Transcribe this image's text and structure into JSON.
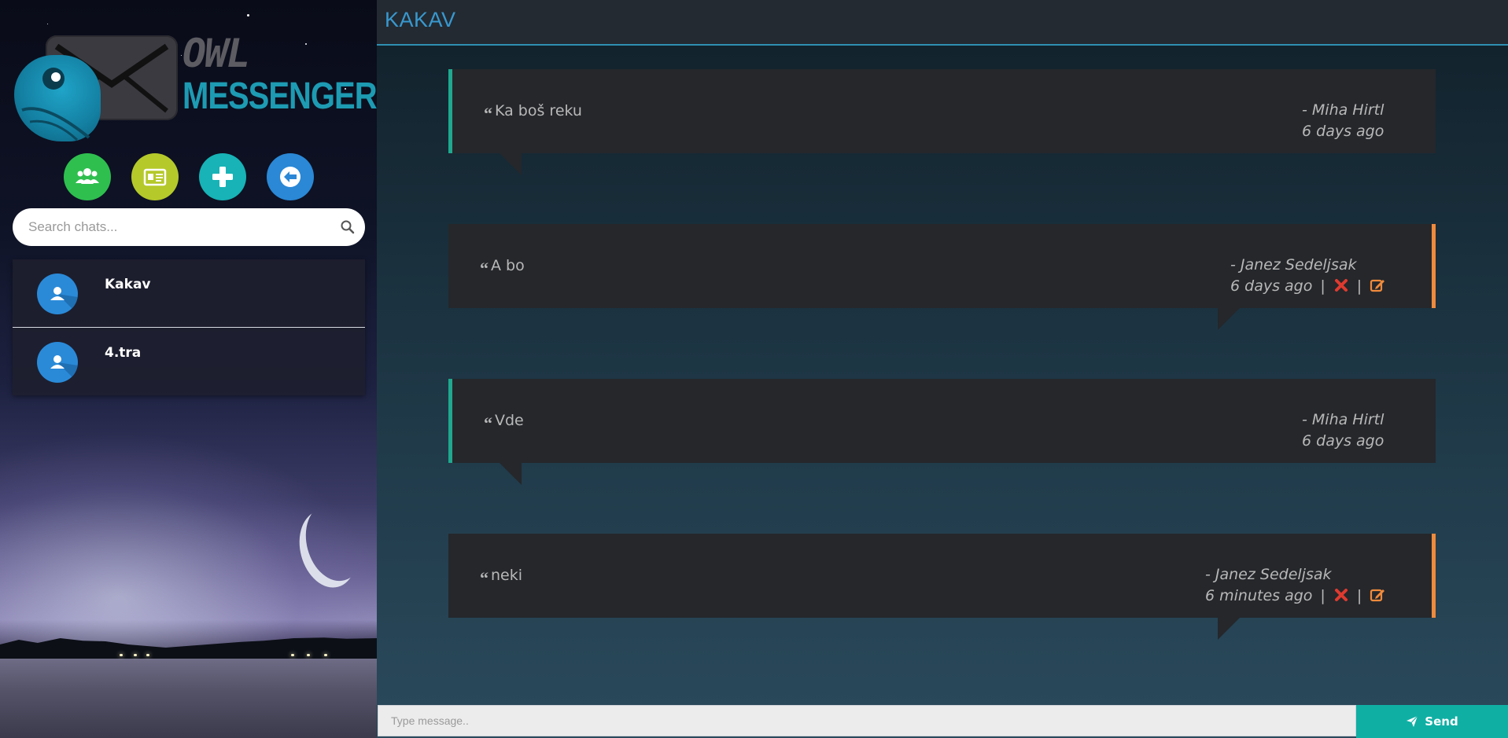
{
  "app": {
    "logo_line1": "OWL",
    "logo_line2": "MESSENGER"
  },
  "sidebar": {
    "actions": [
      {
        "name": "groups",
        "icon": "users-icon",
        "color": "#2fbf4f"
      },
      {
        "name": "contacts",
        "icon": "id-card-icon",
        "color": "#b5c92a"
      },
      {
        "name": "new-chat",
        "icon": "plus-icon",
        "color": "#17b3b6"
      },
      {
        "name": "logout",
        "icon": "arrow-left-circle-icon",
        "color": "#2a88d6"
      }
    ],
    "search": {
      "placeholder": "Search chats...",
      "value": ""
    },
    "chats": [
      {
        "name": "Kakav"
      },
      {
        "name": "4.tra"
      }
    ]
  },
  "chat": {
    "title": "KAKAV",
    "messages": [
      {
        "text": "Ka boš reku",
        "author": "- Miha Hirtl",
        "time": "6 days ago",
        "own": false
      },
      {
        "text": "A bo",
        "author": "- Janez Sedeljsak",
        "time": "6 days ago",
        "own": true
      },
      {
        "text": "Vde",
        "author": "- Miha Hirtl",
        "time": "6 days ago",
        "own": false
      },
      {
        "text": "neki",
        "author": "- Janez Sedeljsak",
        "time": "6 minutes ago",
        "own": true
      }
    ],
    "separator": "|"
  },
  "compose": {
    "placeholder": "Type message..",
    "value": "",
    "send_label": "Send"
  },
  "colors": {
    "accent": "#3898cf",
    "own_border": "#f08a3c",
    "other_border": "#1fa88f",
    "send": "#10afa4",
    "delete": "#e03a2f",
    "edit": "#f08a3c"
  }
}
